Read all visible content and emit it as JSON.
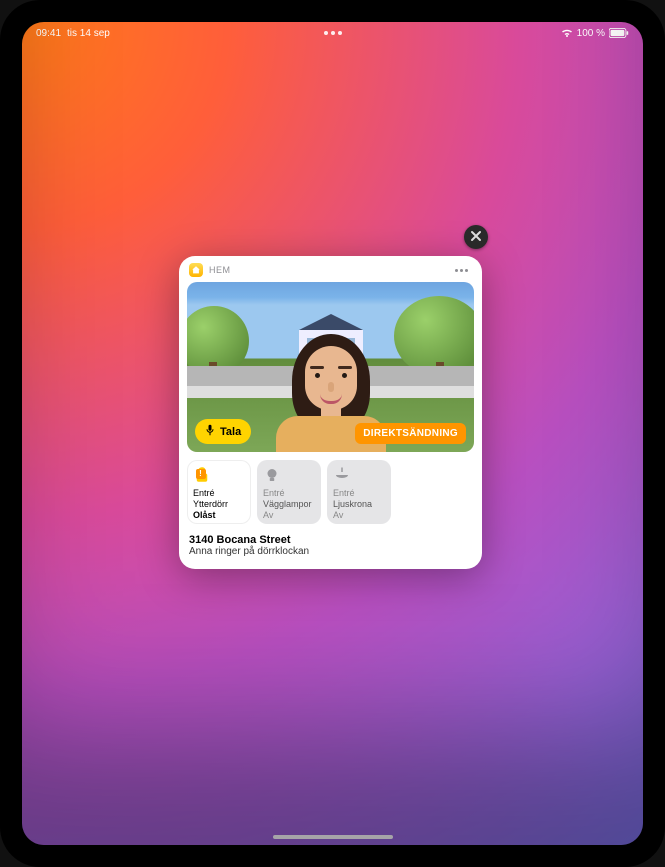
{
  "status": {
    "time": "09:41",
    "date": "tis 14 sep",
    "battery_text": "100 %"
  },
  "notification": {
    "app_label": "HEM",
    "video": {
      "talk_label": "Tala",
      "live_label": "DIREKTSÄNDNING"
    },
    "tiles": [
      {
        "icon": "lock-open-icon",
        "room": "Entré",
        "name": "Ytterdörr",
        "state": "Olåst",
        "on": true,
        "warn": true
      },
      {
        "icon": "bulb-icon",
        "room": "Entré",
        "name": "Vägglampor",
        "state": "Av",
        "on": false,
        "warn": false
      },
      {
        "icon": "chandelier-icon",
        "room": "Entré",
        "name": "Ljuskrona",
        "state": "Av",
        "on": false,
        "warn": false
      }
    ],
    "address": "3140 Bocana Street",
    "message": "Anna ringer på dörrklockan"
  }
}
